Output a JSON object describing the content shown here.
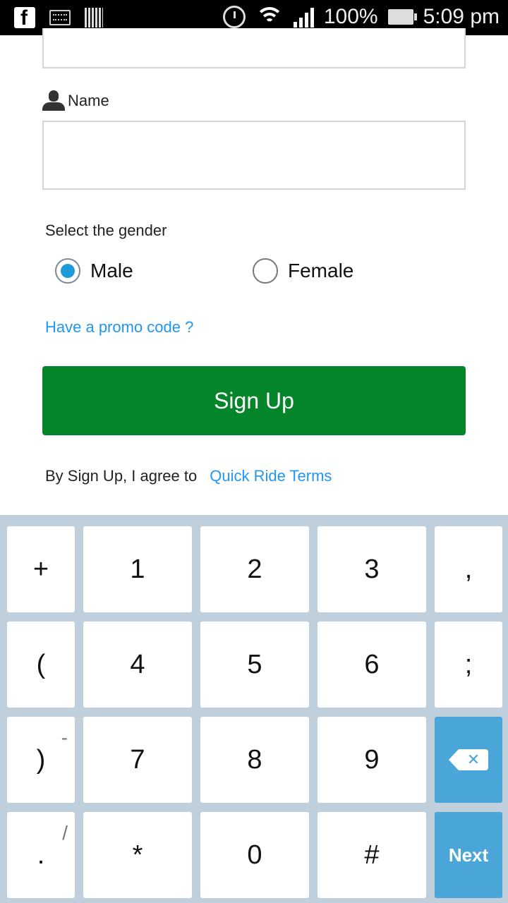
{
  "status_bar": {
    "battery": "100%",
    "time": "5:09 pm"
  },
  "form": {
    "name_label": "Name",
    "name_value": "",
    "gender_label": "Select the gender",
    "gender_options": [
      {
        "label": "Male",
        "selected": true
      },
      {
        "label": "Female",
        "selected": false
      }
    ],
    "promo_link": "Have a promo code ?",
    "signup_label": "Sign Up",
    "terms_text": "By Sign Up, I agree to",
    "terms_link": "Quick Ride Terms"
  },
  "keyboard": {
    "rows": [
      [
        {
          "main": "+"
        },
        {
          "main": "1"
        },
        {
          "main": "2"
        },
        {
          "main": "3"
        },
        {
          "main": ","
        }
      ],
      [
        {
          "main": "("
        },
        {
          "main": "4"
        },
        {
          "main": "5"
        },
        {
          "main": "6"
        },
        {
          "main": ";"
        }
      ],
      [
        {
          "main": ")",
          "sub": "-"
        },
        {
          "main": "7"
        },
        {
          "main": "8"
        },
        {
          "main": "9"
        },
        {
          "main": "backspace"
        }
      ],
      [
        {
          "main": ".",
          "sub": "/"
        },
        {
          "main": "*"
        },
        {
          "main": "0"
        },
        {
          "main": "#"
        },
        {
          "main": "Next"
        }
      ]
    ]
  },
  "colors": {
    "accent_green": "#05852a",
    "link_blue": "#2196f3",
    "key_blue": "#4aa6d8",
    "keyboard_bg": "#bfd0dc"
  },
  "icons": [
    "facebook-icon",
    "keyboard-icon",
    "barcode-icon",
    "alarm-icon",
    "wifi-icon",
    "signal-icon",
    "battery-icon",
    "person-icon",
    "backspace-icon"
  ]
}
